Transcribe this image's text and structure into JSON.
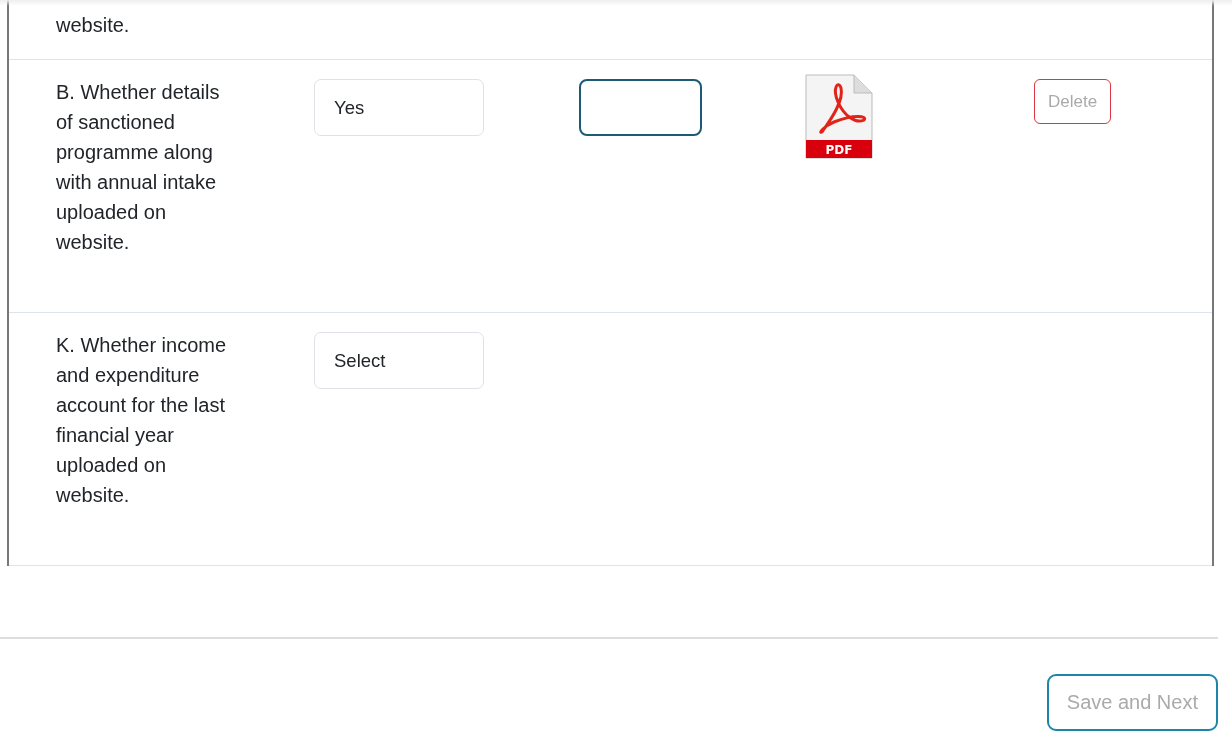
{
  "rows": [
    {
      "question": "website."
    },
    {
      "question": "B. Whether details of sanctioned programme along with annual intake uploaded on website.",
      "answer": "Yes",
      "attachment": {
        "file_type": "PDF",
        "delete_label": "Delete"
      }
    },
    {
      "question": "K. Whether income and expenditure account for the last financial year uploaded on website.",
      "answer": "Select"
    }
  ],
  "save_button": "Save and Next"
}
